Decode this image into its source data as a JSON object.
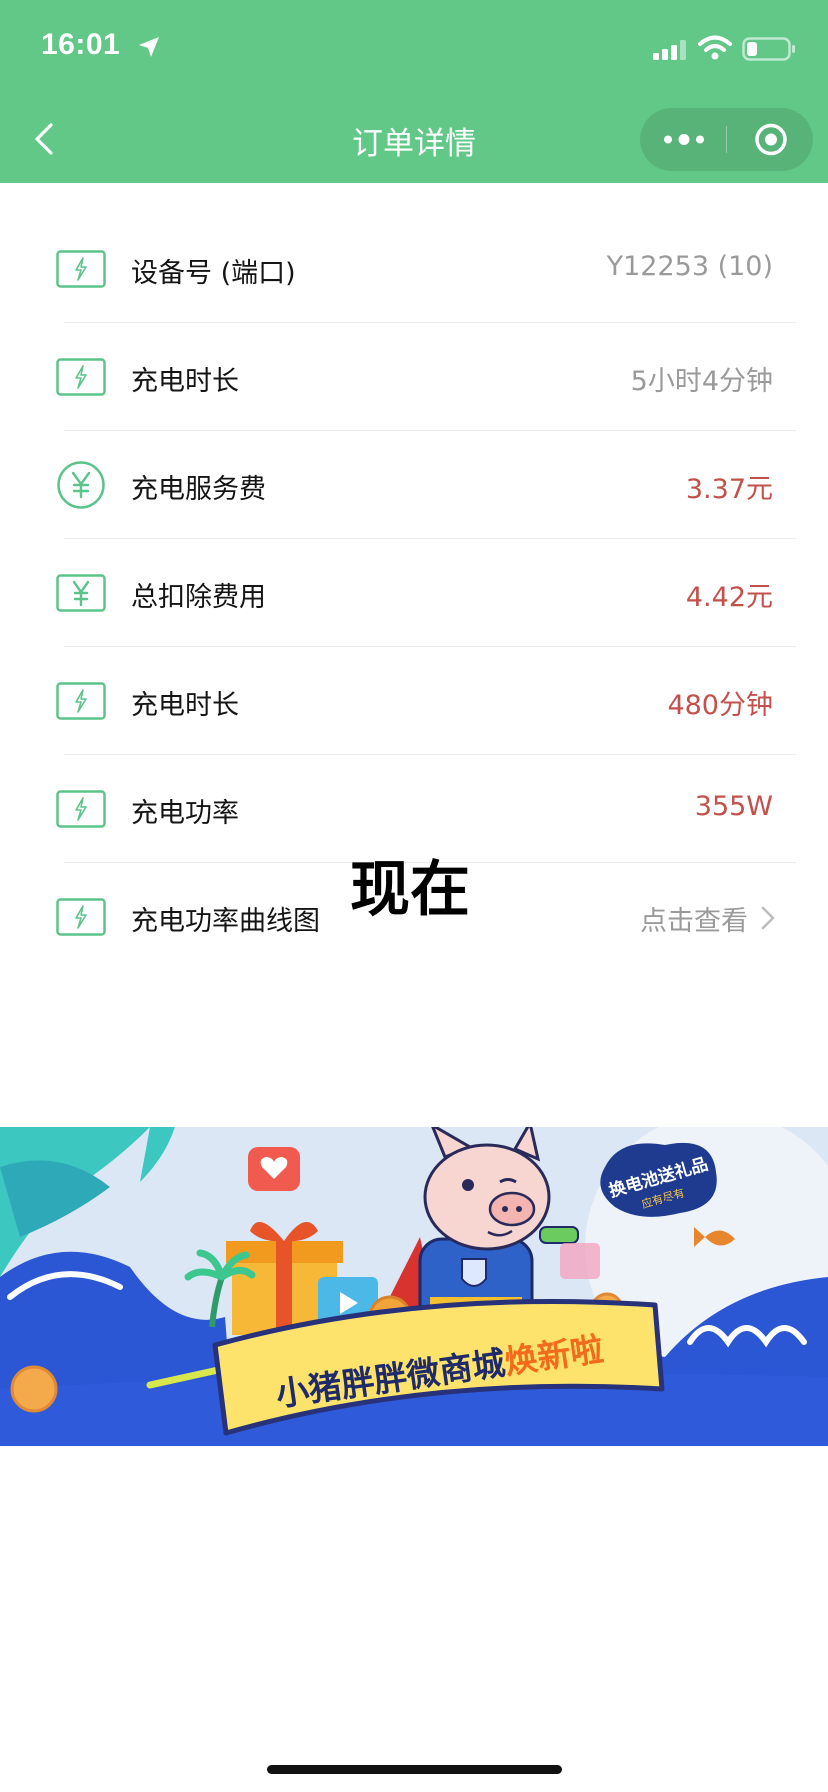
{
  "status_bar": {
    "time": "16:01",
    "icons": [
      "location-arrow-icon",
      "signal-icon",
      "wifi-icon",
      "battery-icon"
    ]
  },
  "nav": {
    "title": "订单详情",
    "back_icon": "chevron-left-icon",
    "more_icon": "more-dots-icon",
    "close_icon": "target-circle-icon"
  },
  "colors": {
    "header": "#62C887",
    "icon_green": "#5CC48A",
    "muted": "#9A9A9A",
    "accent": "#C4504B",
    "link": "#9A9A9A"
  },
  "rows": [
    {
      "icon": "lightning-box-icon",
      "label": "设备号 (端口)",
      "value": "Y12253 (10)",
      "tone": "muted"
    },
    {
      "icon": "lightning-box-icon",
      "label": "充电时长",
      "value": "5小时4分钟",
      "tone": "muted"
    },
    {
      "icon": "yen-circle-icon",
      "label": "充电服务费",
      "value": "3.37元",
      "tone": "accent"
    },
    {
      "icon": "yen-box-icon",
      "label": "总扣除费用",
      "value": "4.42元",
      "tone": "accent"
    },
    {
      "icon": "lightning-box-icon",
      "label": "充电时长",
      "value": "480分钟",
      "tone": "accent"
    },
    {
      "icon": "lightning-box-icon",
      "label": "充电功率",
      "value": "355W",
      "tone": "accent"
    },
    {
      "icon": "lightning-box-icon",
      "label": "充电功率曲线图",
      "value": "点击查看",
      "tone": "link"
    }
  ],
  "overlay_text": "现在",
  "banner": {
    "headline_main": "小猪胖胖微商城",
    "headline_highlight": "焕新啦",
    "badge_line1": "换电池送礼品",
    "badge_line2": "应有尽有",
    "coin_symbol": "¥"
  }
}
